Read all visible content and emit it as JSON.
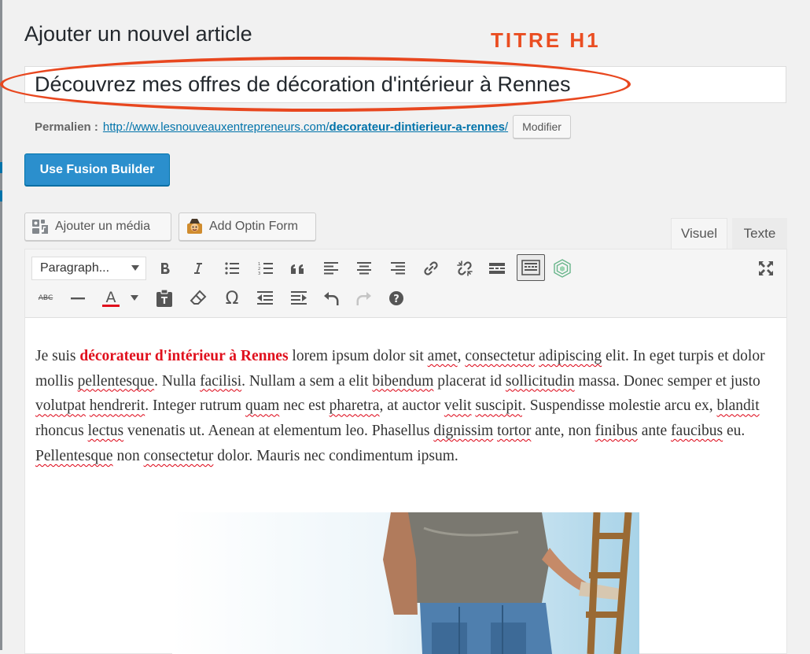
{
  "page": {
    "title": "Ajouter un nouvel article",
    "annotation": "TITRE H1"
  },
  "post": {
    "title_value": "Découvrez mes offres de décoration d'intérieur à Rennes",
    "permalink_label": "Permalien :",
    "permalink_base": "http://www.lesnouveauxentrepreneurs.com/",
    "permalink_slug": "decorateur-dintierieur-a-rennes",
    "permalink_trailing": "/",
    "modify_label": "Modifier"
  },
  "buttons": {
    "fusion_builder": "Use Fusion Builder",
    "add_media": "Ajouter un média",
    "add_optin": "Add Optin Form"
  },
  "tabs": {
    "visual": "Visuel",
    "text": "Texte"
  },
  "toolbar": {
    "format_select": "Paragraph..."
  },
  "content": {
    "p0": "Je suis ",
    "highlight": "décorateur d'intérieur à Rennes",
    "p1": " lorem ipsum dolor sit ",
    "w1": "amet",
    "p2": ", ",
    "w2": "consectetur",
    "p3": " ",
    "w3": "adipiscing",
    "p4": " elit. In eget turpis et dolor mollis ",
    "w4": "pellentesque",
    "p5": ". Nulla ",
    "w5": "facilisi",
    "p6": ". Nullam a sem a elit ",
    "w6": "bibendum",
    "p7": " placerat id ",
    "w7": "sollicitudin",
    "p8": " massa. Donec semper et justo ",
    "w8": "volutpat",
    "p9": " ",
    "w9": "hendrerit",
    "p10": ". Integer rutrum ",
    "w10": "quam",
    "p11": " nec est ",
    "w11": "pharetra",
    "p12": ", at auctor ",
    "w12": "velit",
    "p13": " ",
    "w13": "suscipit",
    "p14": ". Suspendisse molestie arcu ex, ",
    "w14": "blandit",
    "p15": " rhoncus ",
    "w15": "lectus",
    "p16": " venenatis ut. Aenean at elementum leo. Phasellus ",
    "w16": "dignissim",
    "p17": " ",
    "w17": "tortor",
    "p18": " ante, non ",
    "w18": "finibus",
    "p19": " ante ",
    "w19": "faucibus",
    "p20": " eu. ",
    "w20": "Pellentesque",
    "p21": " non ",
    "w21": "consectetur",
    "p22": " dolor. Mauris nec condimentum ipsum."
  },
  "colors": {
    "annotation": "#ea4d21",
    "highlight": "#e0101d",
    "primary_button": "#2b8fcd",
    "link": "#0073aa"
  }
}
